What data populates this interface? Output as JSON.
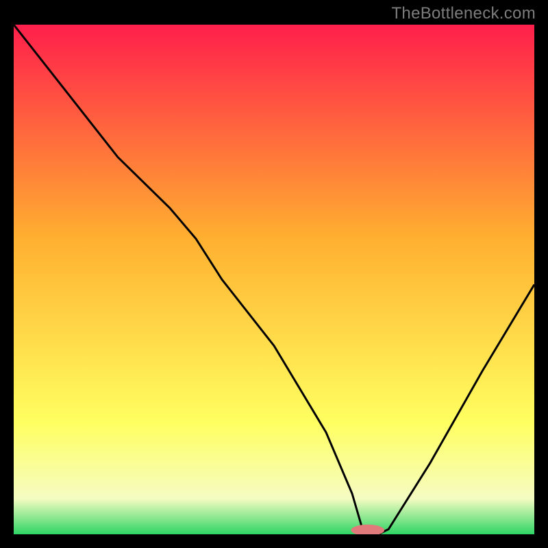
{
  "watermark": "TheBottleneck.com",
  "chart_data": {
    "type": "line",
    "title": "",
    "xlabel": "",
    "ylabel": "",
    "xlim": [
      0,
      100
    ],
    "ylim": [
      0,
      100
    ],
    "grid": false,
    "legend": "none",
    "gradient_colors": {
      "top": "#ff1f4b",
      "mid_upper": "#ffb030",
      "mid_lower": "#ffff60",
      "pale": "#f5fcc2",
      "green": "#2fd565"
    },
    "series": [
      {
        "name": "bottleneck-curve",
        "color": "#000000",
        "x": [
          0,
          10,
          20,
          30,
          35,
          40,
          50,
          60,
          65,
          67,
          70,
          72,
          80,
          90,
          100
        ],
        "y": [
          100,
          87,
          74,
          64,
          58,
          50,
          37,
          20,
          8,
          1,
          0,
          1,
          14,
          32,
          49
        ]
      }
    ],
    "marker": {
      "x": 68,
      "y": 0,
      "rx": 3.2,
      "ry": 1.1,
      "color": "#e17a7a"
    },
    "annotations": []
  }
}
